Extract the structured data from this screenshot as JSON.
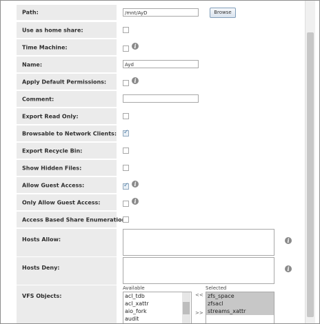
{
  "form": {
    "path_label": "Path:",
    "path_value": "/mnt/AyD",
    "browse_label": "Browse",
    "home_share_label": "Use as home share:",
    "time_machine_label": "Time Machine:",
    "name_label": "Name:",
    "name_value": "Ayd",
    "apply_perms_label": "Apply Default Permissions:",
    "comment_label": "Comment:",
    "comment_value": "",
    "export_ro_label": "Export Read Only:",
    "browsable_label": "Browsable to Network Clients:",
    "recycle_label": "Export Recycle Bin:",
    "hidden_label": "Show Hidden Files:",
    "guest_label": "Allow Guest Access:",
    "guest_only_label": "Only Allow Guest Access:",
    "abse_label": "Access Based Share Enumeration:",
    "hosts_allow_label": "Hosts Allow:",
    "hosts_deny_label": "Hosts Deny:",
    "vfs_label": "VFS Objects:",
    "available_label": "Available",
    "selected_label": "Selected",
    "move_left": "<<",
    "move_right": ">>",
    "info_glyph": "i",
    "available_items": [
      "acl_tdb",
      "acl_xattr",
      "aio_fork",
      "audit"
    ],
    "selected_items": [
      "zfs_space",
      "zfsacl",
      "streams_xattr"
    ]
  }
}
